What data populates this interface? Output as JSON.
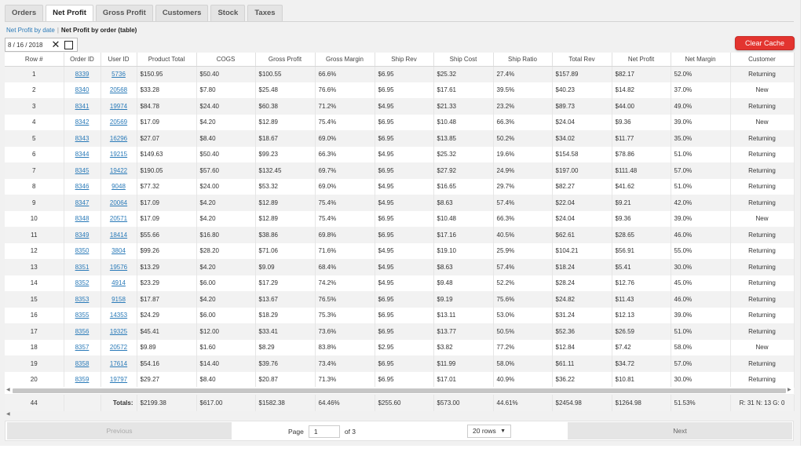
{
  "tabs": [
    {
      "label": "Orders",
      "active": false
    },
    {
      "label": "Net Profit",
      "active": true
    },
    {
      "label": "Gross Profit",
      "active": false
    },
    {
      "label": "Customers",
      "active": false
    },
    {
      "label": "Stock",
      "active": false
    },
    {
      "label": "Taxes",
      "active": false
    }
  ],
  "subnav": {
    "link_label": "Net Profit by date",
    "separator": "|",
    "current_label": "Net Profit by order (table)"
  },
  "date_filter": {
    "value": "8 / 16 / 2018",
    "clear_icon": "close-icon",
    "calendar_icon": "calendar-icon"
  },
  "clear_cache_label": "Clear Cache",
  "colors": {
    "accent_red": "#e3342f",
    "link_blue": "#2a7ab8"
  },
  "table": {
    "columns": [
      "Row #",
      "Order ID",
      "User ID",
      "Product Total",
      "COGS",
      "Gross Profit",
      "Gross Margin",
      "Ship Rev",
      "Ship Cost",
      "Ship Ratio",
      "Total Rev",
      "Net Profit",
      "Net Margin",
      "Customer"
    ],
    "rows": [
      [
        "1",
        "8339",
        "5736",
        "$150.95",
        "$50.40",
        "$100.55",
        "66.6%",
        "$6.95",
        "$25.32",
        "27.4%",
        "$157.89",
        "$82.17",
        "52.0%",
        "Returning"
      ],
      [
        "2",
        "8340",
        "20568",
        "$33.28",
        "$7.80",
        "$25.48",
        "76.6%",
        "$6.95",
        "$17.61",
        "39.5%",
        "$40.23",
        "$14.82",
        "37.0%",
        "New"
      ],
      [
        "3",
        "8341",
        "19974",
        "$84.78",
        "$24.40",
        "$60.38",
        "71.2%",
        "$4.95",
        "$21.33",
        "23.2%",
        "$89.73",
        "$44.00",
        "49.0%",
        "Returning"
      ],
      [
        "4",
        "8342",
        "20569",
        "$17.09",
        "$4.20",
        "$12.89",
        "75.4%",
        "$6.95",
        "$10.48",
        "66.3%",
        "$24.04",
        "$9.36",
        "39.0%",
        "New"
      ],
      [
        "5",
        "8343",
        "16296",
        "$27.07",
        "$8.40",
        "$18.67",
        "69.0%",
        "$6.95",
        "$13.85",
        "50.2%",
        "$34.02",
        "$11.77",
        "35.0%",
        "Returning"
      ],
      [
        "6",
        "8344",
        "19215",
        "$149.63",
        "$50.40",
        "$99.23",
        "66.3%",
        "$4.95",
        "$25.32",
        "19.6%",
        "$154.58",
        "$78.86",
        "51.0%",
        "Returning"
      ],
      [
        "7",
        "8345",
        "19422",
        "$190.05",
        "$57.60",
        "$132.45",
        "69.7%",
        "$6.95",
        "$27.92",
        "24.9%",
        "$197.00",
        "$111.48",
        "57.0%",
        "Returning"
      ],
      [
        "8",
        "8346",
        "9048",
        "$77.32",
        "$24.00",
        "$53.32",
        "69.0%",
        "$4.95",
        "$16.65",
        "29.7%",
        "$82.27",
        "$41.62",
        "51.0%",
        "Returning"
      ],
      [
        "9",
        "8347",
        "20064",
        "$17.09",
        "$4.20",
        "$12.89",
        "75.4%",
        "$4.95",
        "$8.63",
        "57.4%",
        "$22.04",
        "$9.21",
        "42.0%",
        "Returning"
      ],
      [
        "10",
        "8348",
        "20571",
        "$17.09",
        "$4.20",
        "$12.89",
        "75.4%",
        "$6.95",
        "$10.48",
        "66.3%",
        "$24.04",
        "$9.36",
        "39.0%",
        "New"
      ],
      [
        "11",
        "8349",
        "18414",
        "$55.66",
        "$16.80",
        "$38.86",
        "69.8%",
        "$6.95",
        "$17.16",
        "40.5%",
        "$62.61",
        "$28.65",
        "46.0%",
        "Returning"
      ],
      [
        "12",
        "8350",
        "3804",
        "$99.26",
        "$28.20",
        "$71.06",
        "71.6%",
        "$4.95",
        "$19.10",
        "25.9%",
        "$104.21",
        "$56.91",
        "55.0%",
        "Returning"
      ],
      [
        "13",
        "8351",
        "19576",
        "$13.29",
        "$4.20",
        "$9.09",
        "68.4%",
        "$4.95",
        "$8.63",
        "57.4%",
        "$18.24",
        "$5.41",
        "30.0%",
        "Returning"
      ],
      [
        "14",
        "8352",
        "4914",
        "$23.29",
        "$6.00",
        "$17.29",
        "74.2%",
        "$4.95",
        "$9.48",
        "52.2%",
        "$28.24",
        "$12.76",
        "45.0%",
        "Returning"
      ],
      [
        "15",
        "8353",
        "9158",
        "$17.87",
        "$4.20",
        "$13.67",
        "76.5%",
        "$6.95",
        "$9.19",
        "75.6%",
        "$24.82",
        "$11.43",
        "46.0%",
        "Returning"
      ],
      [
        "16",
        "8355",
        "14353",
        "$24.29",
        "$6.00",
        "$18.29",
        "75.3%",
        "$6.95",
        "$13.11",
        "53.0%",
        "$31.24",
        "$12.13",
        "39.0%",
        "Returning"
      ],
      [
        "17",
        "8356",
        "19325",
        "$45.41",
        "$12.00",
        "$33.41",
        "73.6%",
        "$6.95",
        "$13.77",
        "50.5%",
        "$52.36",
        "$26.59",
        "51.0%",
        "Returning"
      ],
      [
        "18",
        "8357",
        "20572",
        "$9.89",
        "$1.60",
        "$8.29",
        "83.8%",
        "$2.95",
        "$3.82",
        "77.2%",
        "$12.84",
        "$7.42",
        "58.0%",
        "New"
      ],
      [
        "19",
        "8358",
        "17614",
        "$54.16",
        "$14.40",
        "$39.76",
        "73.4%",
        "$6.95",
        "$11.99",
        "58.0%",
        "$61.11",
        "$34.72",
        "57.0%",
        "Returning"
      ],
      [
        "20",
        "8359",
        "19797",
        "$29.27",
        "$8.40",
        "$20.87",
        "71.3%",
        "$6.95",
        "$17.01",
        "40.9%",
        "$36.22",
        "$10.81",
        "30.0%",
        "Returning"
      ]
    ]
  },
  "totals": {
    "count": "44",
    "label": "Totals:",
    "product_total": "$2199.38",
    "cogs": "$617.00",
    "gross_profit": "$1582.38",
    "gross_margin": "64.46%",
    "ship_rev": "$255.60",
    "ship_cost": "$573.00",
    "ship_ratio": "44.61%",
    "total_rev": "$2454.98",
    "net_profit": "$1264.98",
    "net_margin": "51.53%",
    "customer": "R: 31 N: 13 G: 0"
  },
  "pagination": {
    "previous_label": "Previous",
    "next_label": "Next",
    "page_label": "Page",
    "page_value": "1",
    "of_label": "of 3",
    "rows_option": "20 rows"
  }
}
